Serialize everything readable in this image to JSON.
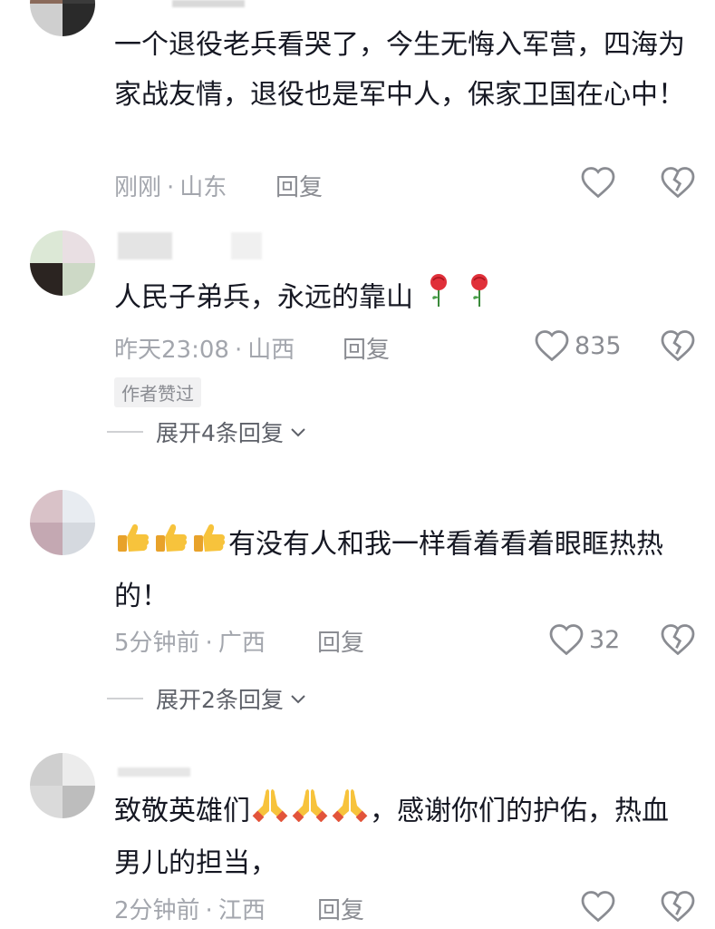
{
  "comments": [
    {
      "text": "一个退役老兵看哭了，今生无悔入军营，四海为家战友情，退役也是军中人，保家卫国在心中！",
      "time": "刚刚",
      "location": "山东",
      "reply_label": "回复",
      "likes": ""
    },
    {
      "text": "人民子弟兵，永远的靠山",
      "time": "昨天23:08",
      "location": "山西",
      "reply_label": "回复",
      "likes": "835",
      "tag": "作者赞过",
      "expand_label": "展开4条回复",
      "emoji": [
        "rose-emoji",
        "rose-emoji"
      ]
    },
    {
      "text": "有没有人和我一样看着看着眼眶热热的！",
      "time": "5分钟前",
      "location": "广西",
      "reply_label": "回复",
      "likes": "32",
      "expand_label": "展开2条回复",
      "emoji": [
        "thumbs-up-emoji",
        "thumbs-up-emoji",
        "thumbs-up-emoji"
      ]
    },
    {
      "text_before": "致敬英雄们",
      "text_after": "，感谢你们的护佑，热血男儿的担当，",
      "time": "2分钟前",
      "location": "江西",
      "reply_label": "回复",
      "likes": "",
      "emoji": [
        "praying-hands-emoji",
        "praying-hands-emoji",
        "praying-hands-emoji"
      ]
    }
  ],
  "colors": {
    "text": "#161823",
    "meta": "#a3a6ad",
    "icon": "#8a8c92"
  }
}
